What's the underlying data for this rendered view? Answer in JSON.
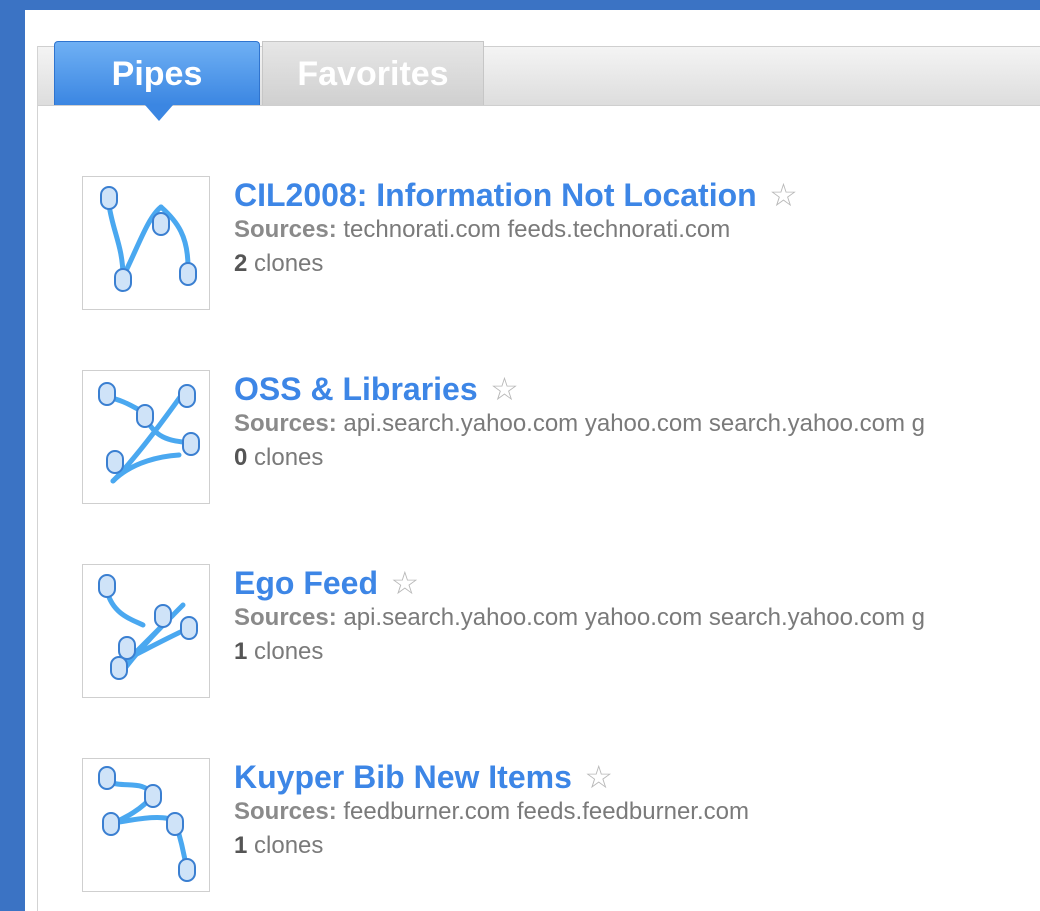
{
  "tabs": [
    {
      "label": "Pipes",
      "active": true
    },
    {
      "label": "Favorites",
      "active": false
    }
  ],
  "sources_label": "Sources:",
  "clones_suffix": "clones",
  "star_glyph": "☆",
  "pipes": [
    {
      "title": "CIL2008: Information Not Location",
      "sources": "technorati.com feeds.technorati.com",
      "clones": "2"
    },
    {
      "title": "OSS & Libraries",
      "sources": "api.search.yahoo.com yahoo.com search.yahoo.com g",
      "clones": "0"
    },
    {
      "title": "Ego Feed",
      "sources": "api.search.yahoo.com yahoo.com search.yahoo.com g",
      "clones": "1"
    },
    {
      "title": "Kuyper Bib New Items",
      "sources": "feedburner.com feeds.feedburner.com",
      "clones": "1"
    }
  ],
  "colors": {
    "background": "#3b73c4",
    "link": "#3d86e6",
    "tab_active": "#3b86e2",
    "pipe_stroke": "#4aa8f0"
  },
  "icons": {
    "pipe_thumbnail": "pipe-diagram-icon",
    "favorite": "star-outline-icon"
  }
}
